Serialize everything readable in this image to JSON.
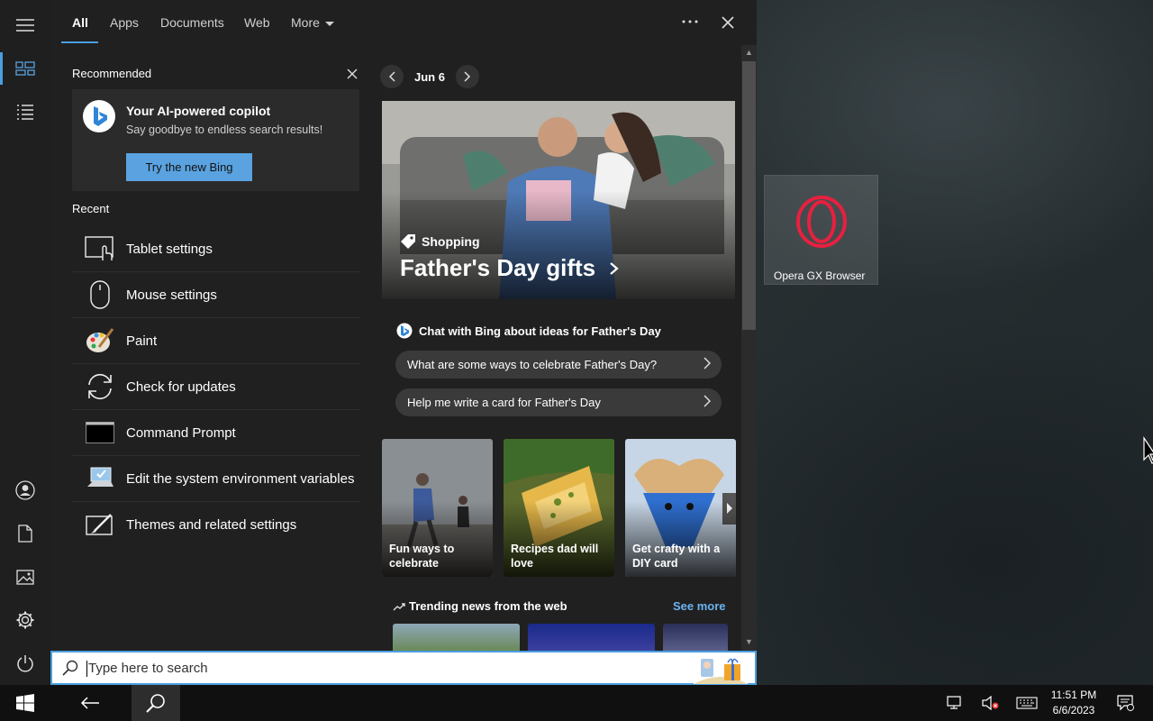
{
  "nav": {
    "tabs": [
      {
        "label": "All"
      },
      {
        "label": "Apps"
      },
      {
        "label": "Documents"
      },
      {
        "label": "Web"
      },
      {
        "label": "More"
      }
    ]
  },
  "recommended": {
    "heading": "Recommended",
    "card": {
      "title": "Your AI-powered copilot",
      "subtitle": "Say goodbye to endless search results!",
      "button": "Try the new Bing"
    }
  },
  "recent": {
    "heading": "Recent",
    "items": [
      {
        "label": "Tablet settings",
        "icon": "tablet-settings-icon"
      },
      {
        "label": "Mouse settings",
        "icon": "mouse-icon"
      },
      {
        "label": "Paint",
        "icon": "paint-icon"
      },
      {
        "label": "Check for updates",
        "icon": "sync-icon"
      },
      {
        "label": "Command Prompt",
        "icon": "command-prompt-icon"
      },
      {
        "label": "Edit the system environment variables",
        "icon": "system-properties-icon"
      },
      {
        "label": "Themes and related settings",
        "icon": "themes-icon"
      }
    ]
  },
  "date": {
    "label": "Jun 6"
  },
  "hero": {
    "category": "Shopping",
    "title": "Father's Day gifts"
  },
  "chat": {
    "heading": "Chat with Bing about ideas for Father's Day",
    "pills": [
      "What are some ways to celebrate Father's Day?",
      "Help me write a card for Father's Day"
    ]
  },
  "cards": [
    {
      "text": "Fun ways to celebrate",
      "color": "#8a8f93"
    },
    {
      "text": "Recipes dad will love",
      "color": "#5b6b2d"
    },
    {
      "text": "Get crafty with a DIY card",
      "color": "#c7d6e6"
    }
  ],
  "trending": {
    "heading": "Trending news from the web",
    "see_more": "See more"
  },
  "search": {
    "placeholder": "Type here to search"
  },
  "desktop": {
    "tile_label": "Opera GX Browser"
  },
  "clock": {
    "time": "11:51 PM",
    "date": "6/6/2023"
  },
  "colors": {
    "accent": "#4a9fe0",
    "panel": "#202020",
    "opera": "#e8203f"
  }
}
